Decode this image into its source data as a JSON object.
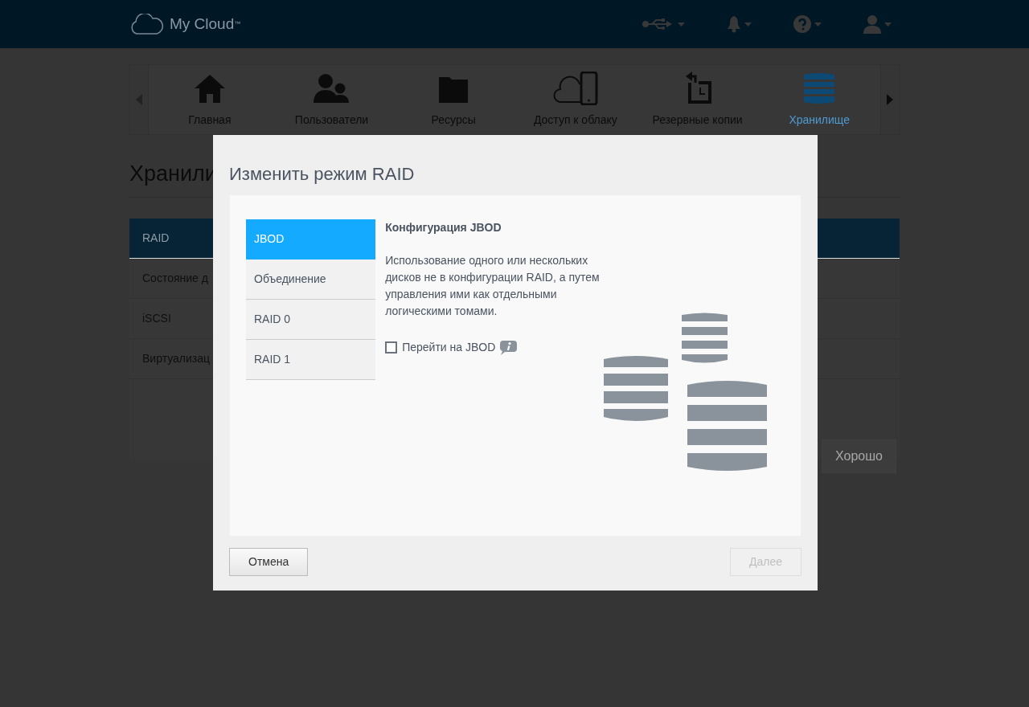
{
  "header": {
    "logo": "My Cloud$^{™}$"
  },
  "nav": [
    {
      "label": "Главная",
      "selected": false
    },
    {
      "label": "Пользователи",
      "selected": false
    },
    {
      "label": "Ресурсы",
      "selected": false
    },
    {
      "label": "Доступ к облаку",
      "selected": false
    },
    {
      "label": "Резервные копии",
      "selected": false
    },
    {
      "label": "Хранилище",
      "selected": true
    }
  ],
  "page": {
    "title": "Хранили",
    "sidebar": [
      {
        "label": "RAID",
        "selected": true
      },
      {
        "label": "Состояние д",
        "selected": false
      },
      {
        "label": "iSCSI",
        "selected": false
      },
      {
        "label": "Виртуализац",
        "selected": false
      }
    ],
    "ok_button": "Хорошо"
  },
  "dialog": {
    "title": "Изменить режим RAID",
    "modes": [
      {
        "label": "JBOD",
        "selected": true
      },
      {
        "label": "Объединение",
        "selected": false
      },
      {
        "label": "RAID 0",
        "selected": false
      },
      {
        "label": "RAID 1",
        "selected": false
      }
    ],
    "heading": "Конфигурация JBOD",
    "description": "Использование одного или нескольких дисков не в конфигурации RAID, а путем управления ими как отдельными логическими томами.",
    "checkbox": {
      "label": "Перейти на JBOD",
      "checked": false
    },
    "cancel": "Отмена",
    "next": {
      "label": "Далее",
      "disabled": true
    }
  }
}
